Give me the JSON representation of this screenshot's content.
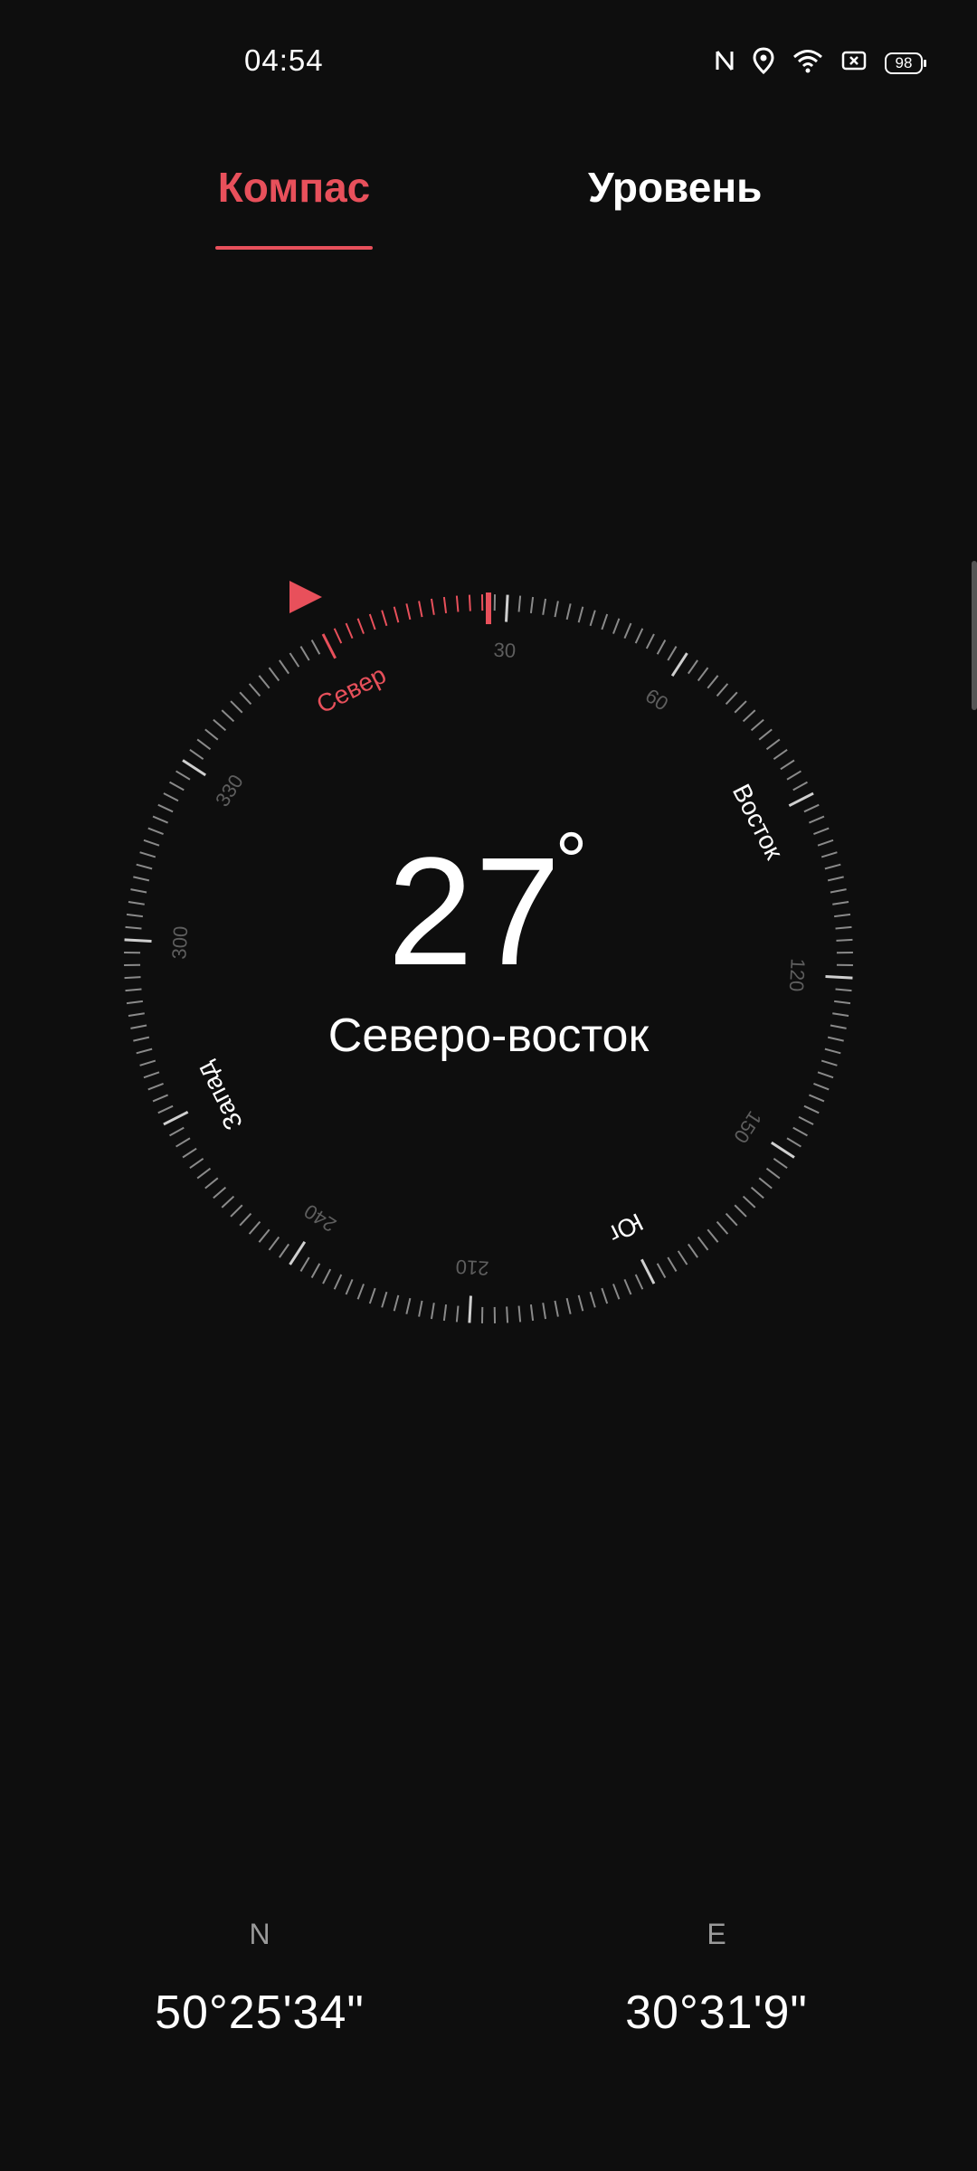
{
  "status_bar": {
    "time": "04:54",
    "icons": [
      "nfc-icon",
      "location-icon",
      "wifi-icon",
      "battery-saver-icon"
    ],
    "battery": "98"
  },
  "tabs": {
    "compass": "Компас",
    "level": "Уровень",
    "active": "compass"
  },
  "compass": {
    "heading_degrees": "27",
    "degree_symbol": "°",
    "direction_text": "Северо-восток",
    "cardinal_labels": {
      "north": "Север",
      "east": "Восток",
      "south": "Юг",
      "west": "Запад"
    },
    "degree_labels": [
      "30",
      "60",
      "120",
      "150",
      "210",
      "240",
      "300",
      "330"
    ],
    "accent_color": "#e8505b"
  },
  "coordinates": {
    "lat_letter": "N",
    "lat_value": "50°25'34\"",
    "lon_letter": "E",
    "lon_value": "30°31'9\""
  }
}
